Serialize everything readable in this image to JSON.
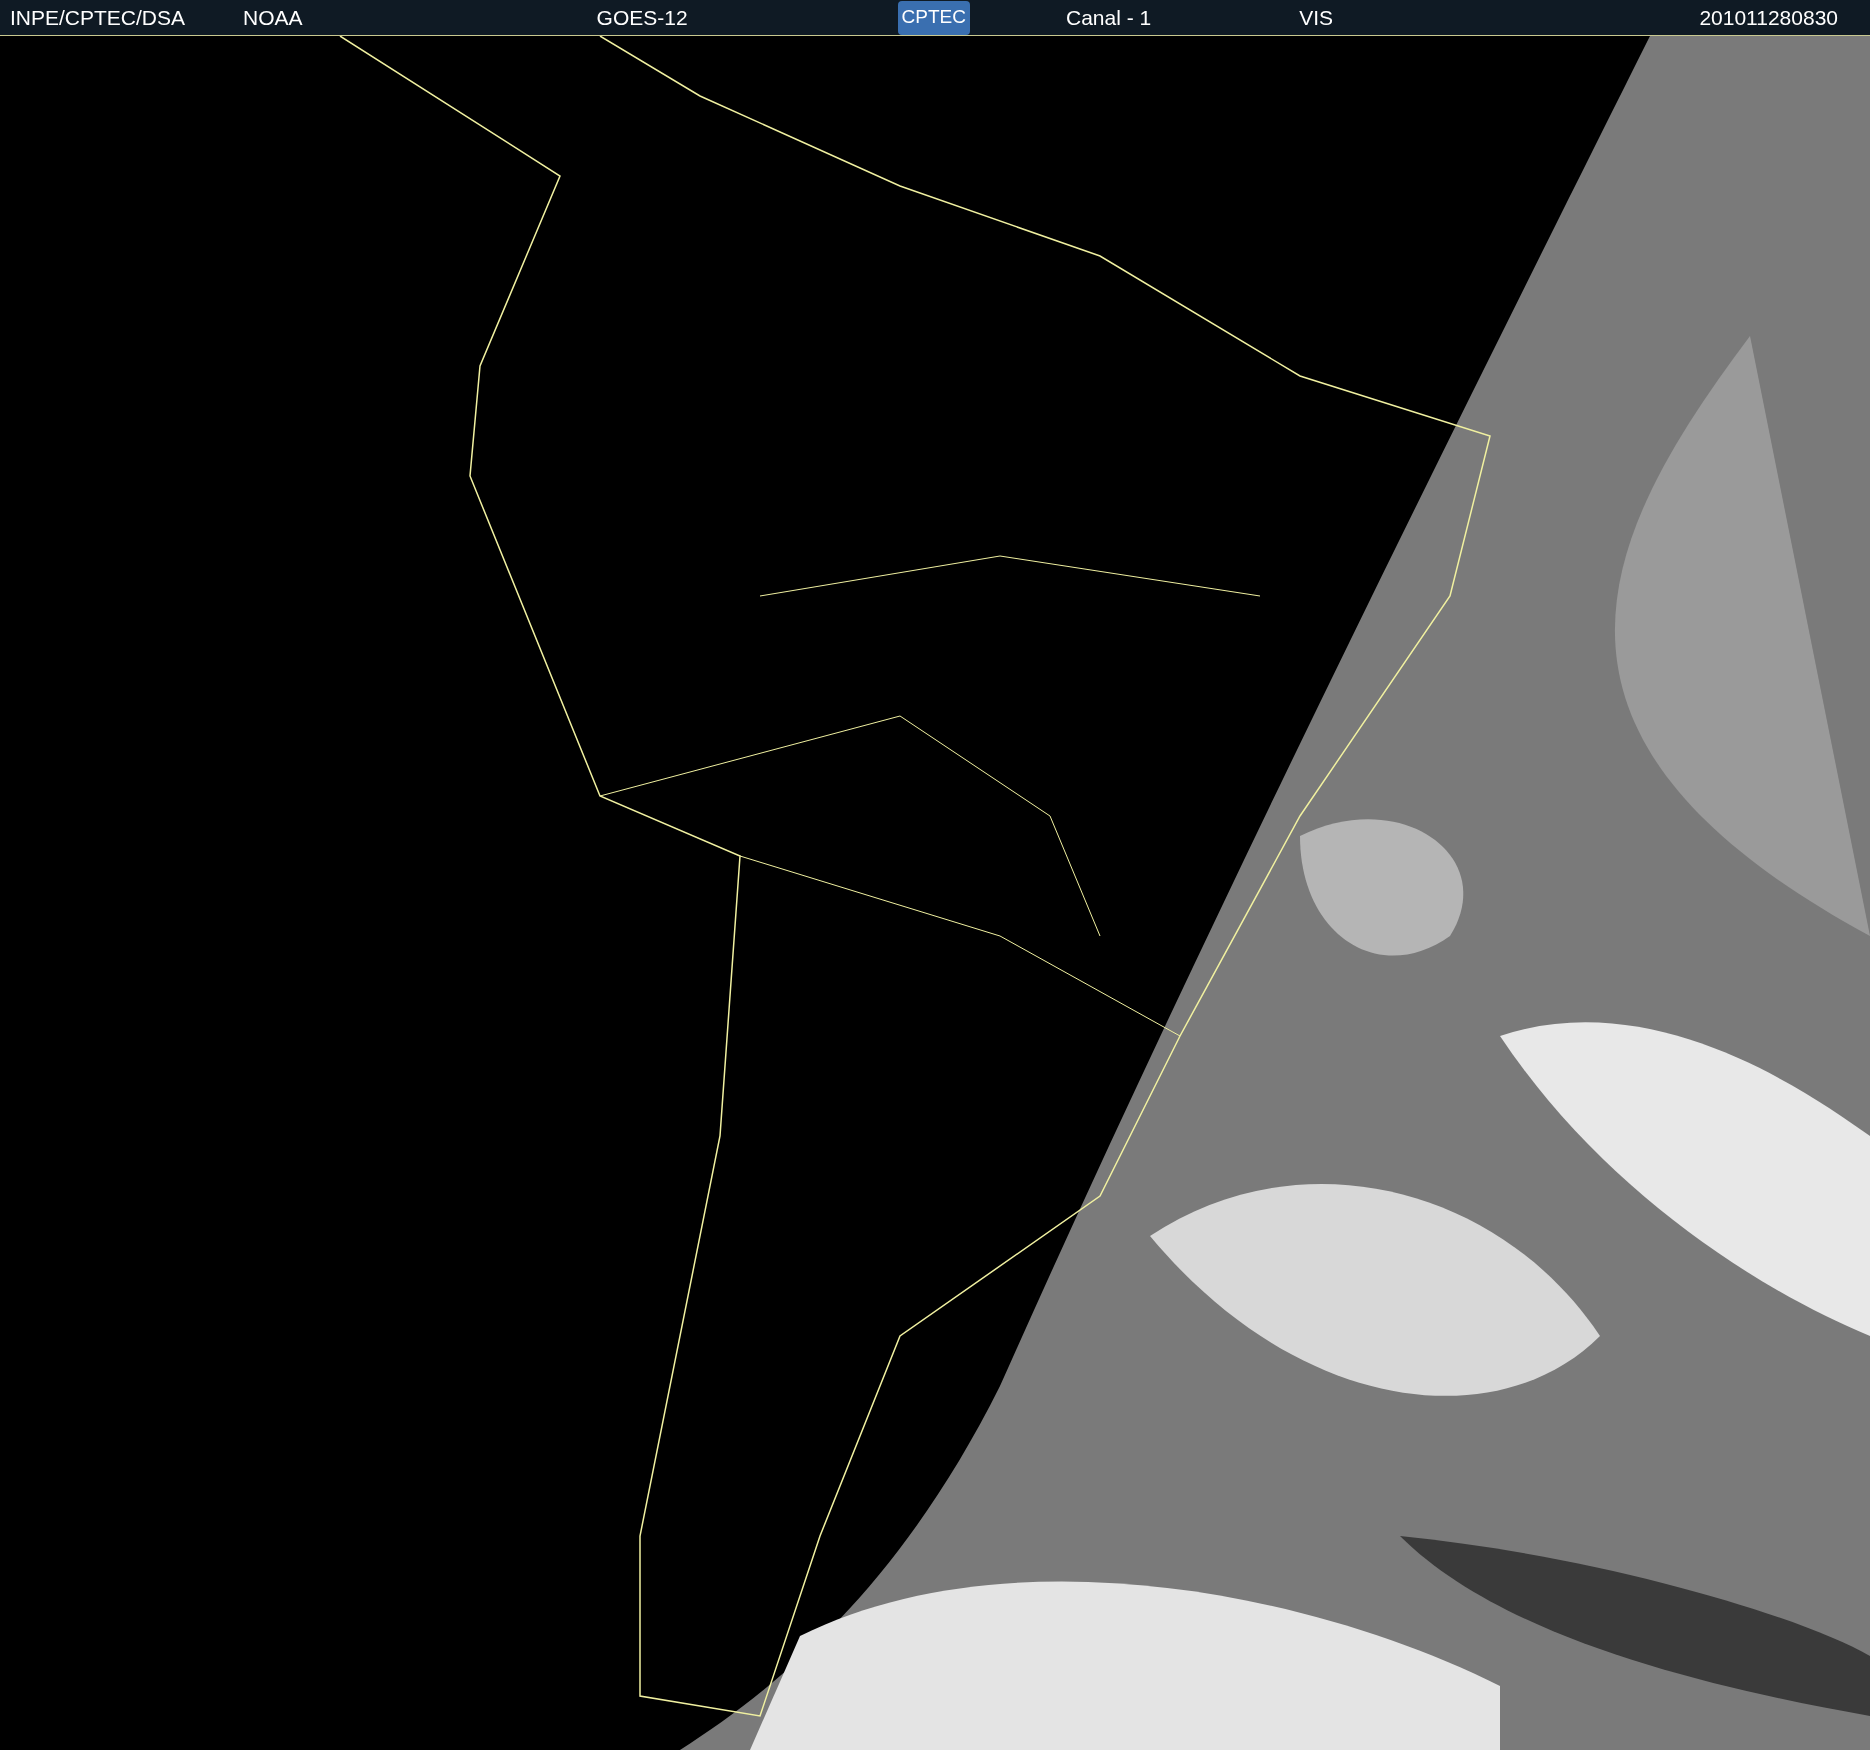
{
  "header": {
    "source": "INPE/CPTEC/DSA",
    "agency": "NOAA",
    "satellite": "GOES-12",
    "logo": "CPTEC",
    "channel": "Canal - 1",
    "band": "VIS",
    "timestamp": "201011280830"
  }
}
